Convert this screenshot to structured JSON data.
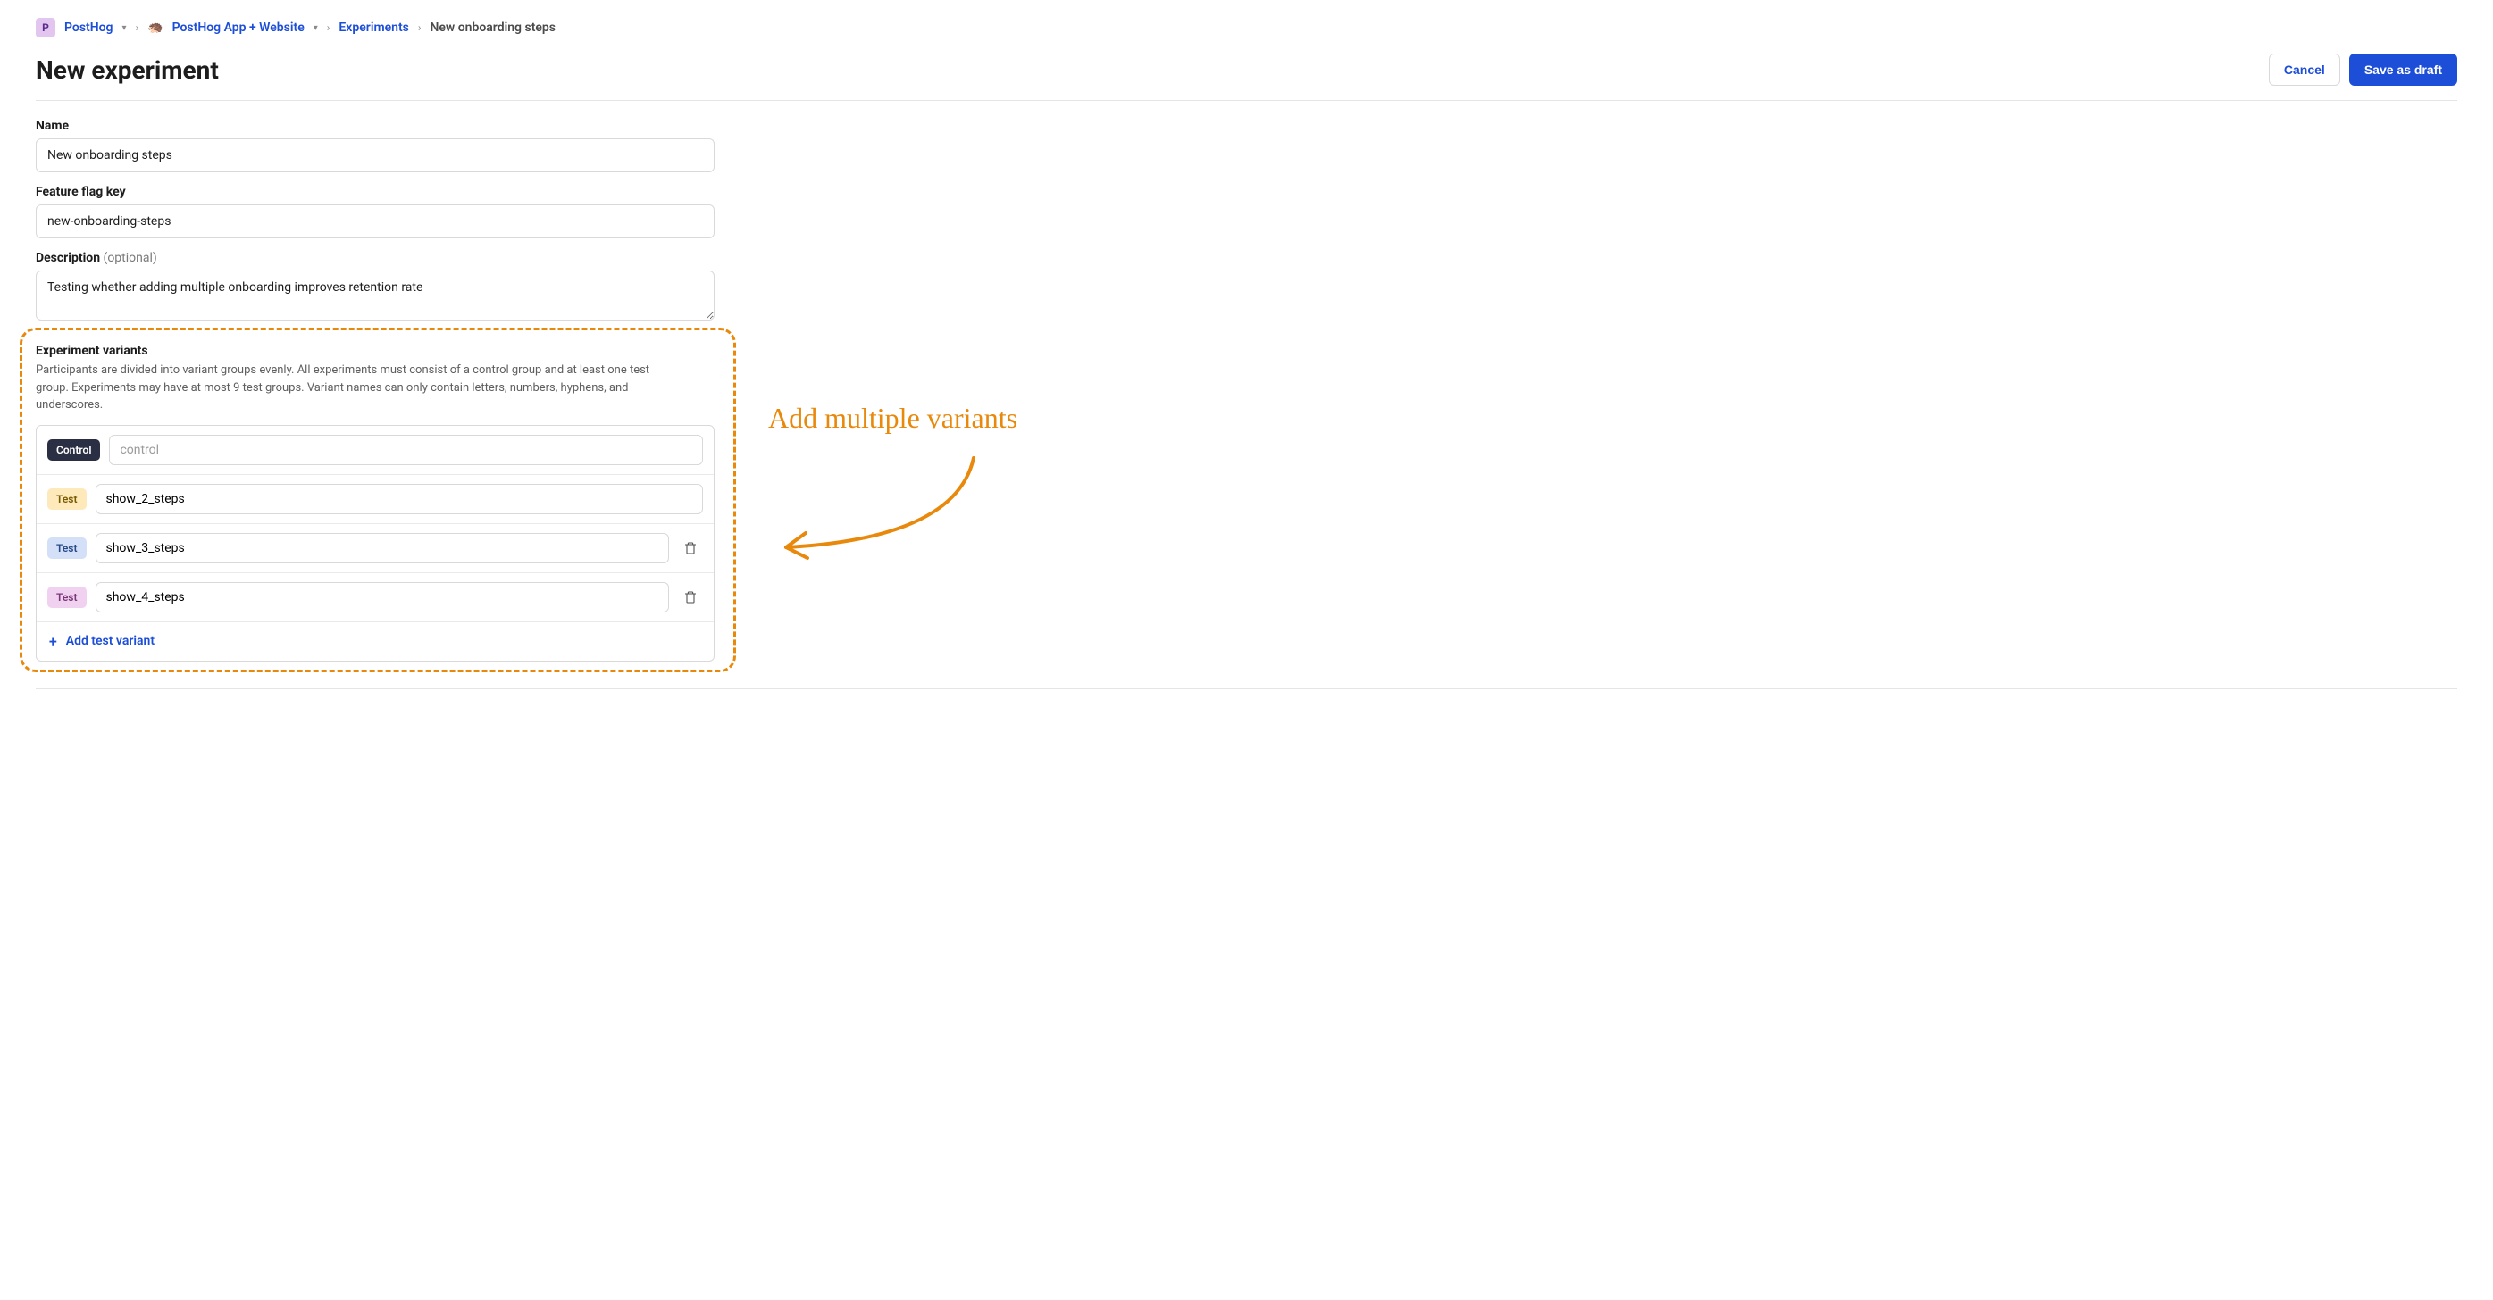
{
  "breadcrumb": {
    "org_badge_letter": "P",
    "org_name": "PostHog",
    "project_name": "PostHog App + Website",
    "section": "Experiments",
    "current": "New onboarding steps"
  },
  "header": {
    "title": "New experiment",
    "cancel_label": "Cancel",
    "save_label": "Save as draft"
  },
  "fields": {
    "name": {
      "label": "Name",
      "value": "New onboarding steps"
    },
    "flag_key": {
      "label": "Feature flag key",
      "value": "new-onboarding-steps"
    },
    "description": {
      "label": "Description",
      "optional_suffix": "(optional)",
      "value": "Testing whether adding multiple onboarding improves retention rate"
    }
  },
  "variants": {
    "heading": "Experiment variants",
    "help": "Participants are divided into variant groups evenly. All experiments must consist of a control group and at least one test group. Experiments may have at most 9 test groups. Variant names can only contain letters, numbers, hyphens, and underscores.",
    "control_badge": "Control",
    "test_badge": "Test",
    "control_placeholder": "control",
    "rows": [
      {
        "type": "control",
        "badge_class": "badge-control",
        "value": "",
        "deletable": false
      },
      {
        "type": "test",
        "badge_class": "badge-test-yellow",
        "value": "show_2_steps",
        "deletable": false
      },
      {
        "type": "test",
        "badge_class": "badge-test-blue",
        "value": "show_3_steps",
        "deletable": true
      },
      {
        "type": "test",
        "badge_class": "badge-test-pink",
        "value": "show_4_steps",
        "deletable": true
      }
    ],
    "add_label": "Add test variant"
  },
  "annotation": {
    "text": "Add multiple variants",
    "color": "#e8890c"
  }
}
